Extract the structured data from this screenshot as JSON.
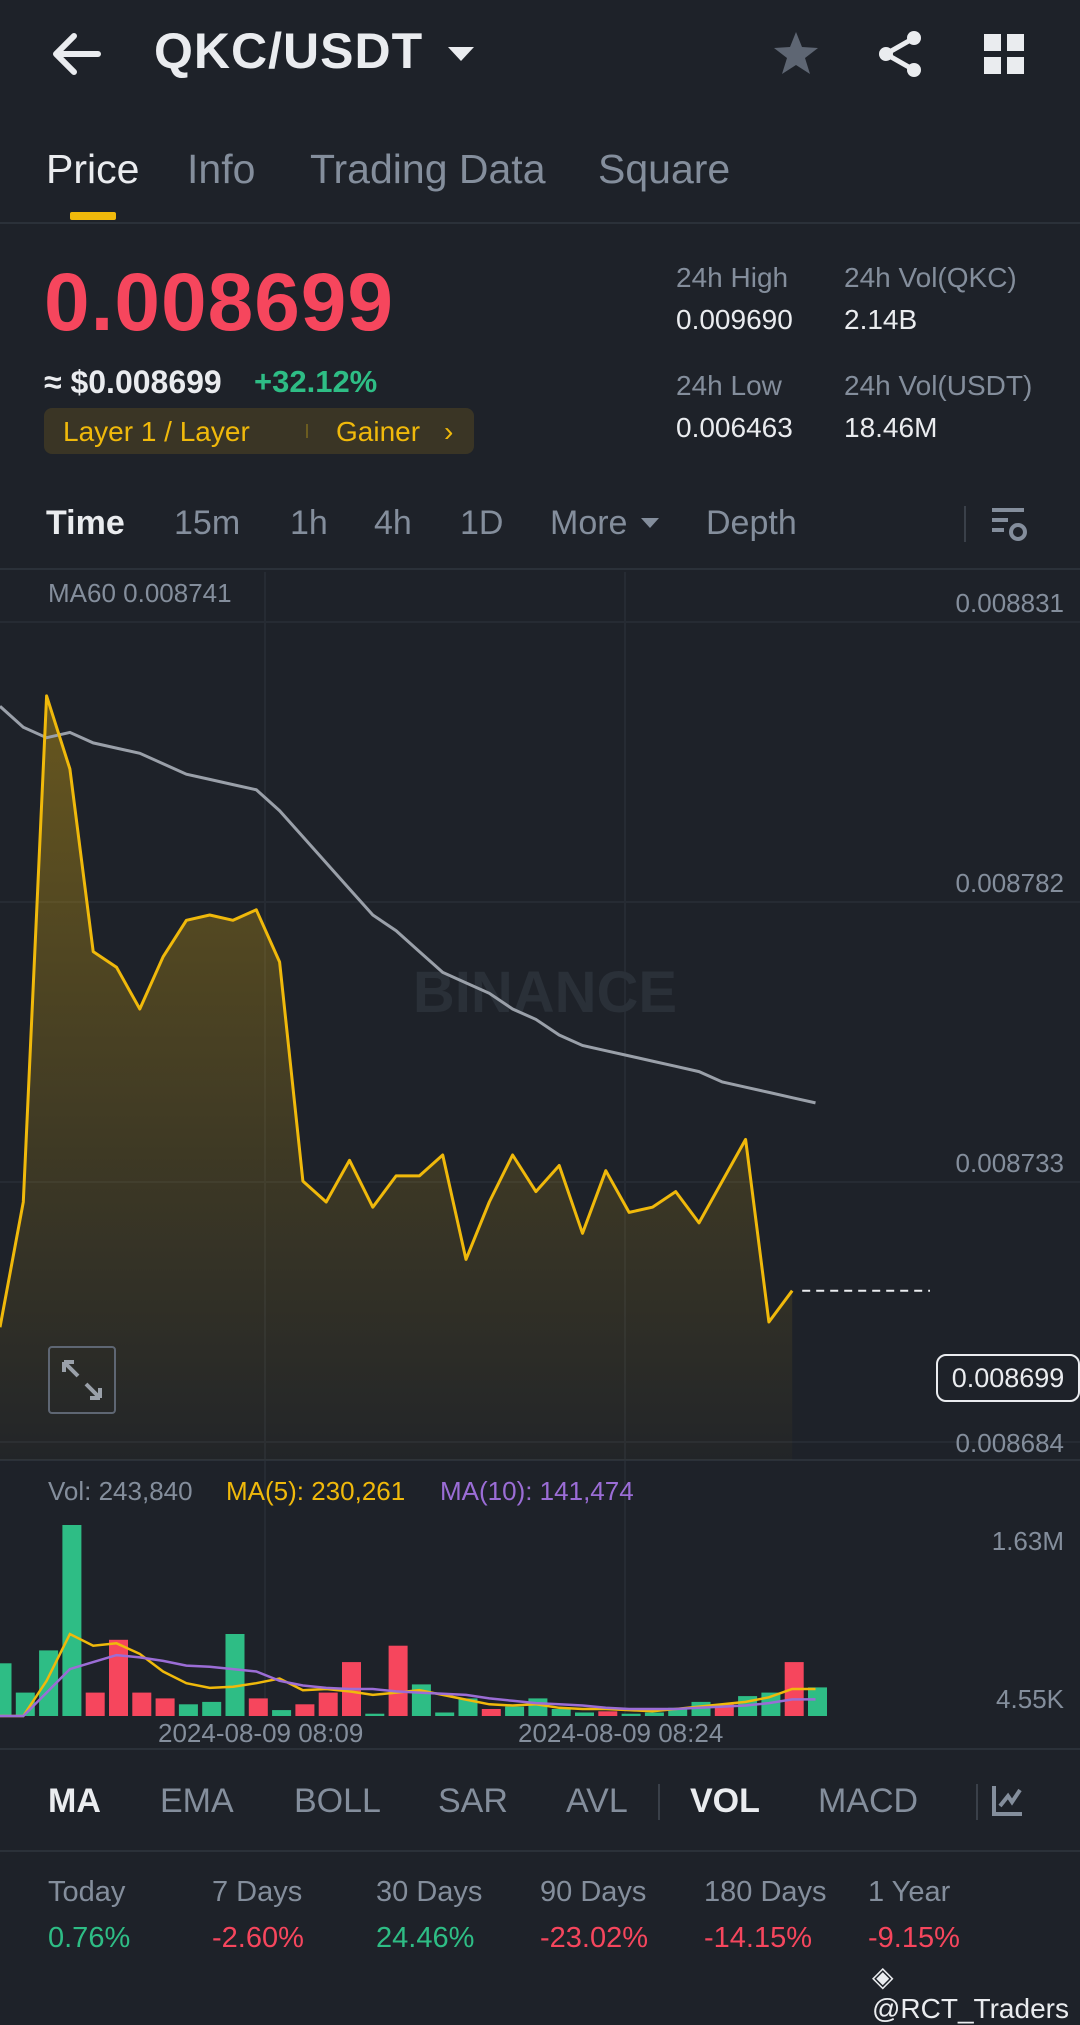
{
  "header": {
    "pair": "QKC/USDT",
    "icons": [
      "back-arrow-icon",
      "dropdown-caret-icon",
      "star-icon",
      "share-icon",
      "grid-icon"
    ]
  },
  "tabs": [
    {
      "label": "Price",
      "active": true
    },
    {
      "label": "Info"
    },
    {
      "label": "Trading Data"
    },
    {
      "label": "Square"
    }
  ],
  "ticker": {
    "last_price": "0.008699",
    "usd_price": "≈ $0.008699",
    "change": "+32.12%",
    "tag_category": "Layer 1 / Layer",
    "tag_rank": "Gainer",
    "high_label": "24h High",
    "high_value": "0.009690",
    "low_label": "24h Low",
    "low_value": "0.006463",
    "vol_base_label": "24h Vol(QKC)",
    "vol_base_value": "2.14B",
    "vol_quote_label": "24h Vol(USDT)",
    "vol_quote_value": "18.46M"
  },
  "intervals": [
    {
      "label": "Time",
      "active": true
    },
    {
      "label": "15m"
    },
    {
      "label": "1h"
    },
    {
      "label": "4h"
    },
    {
      "label": "1D"
    },
    {
      "label": "More"
    },
    {
      "label": "Depth"
    }
  ],
  "chart": {
    "ma_label": "MA60 0.008741",
    "watermark": "BINANCE",
    "price_axis": [
      "0.008831",
      "0.008782",
      "0.008733",
      "0.008684"
    ],
    "current_price_tag": "0.008699",
    "vol_label": "Vol: 243,840",
    "vol_ma5_label": "MA(5): 230,261",
    "vol_ma10_label": "MA(10): 141,474",
    "vol_axis": [
      "1.63M",
      "4.55K"
    ],
    "time_axis": [
      "2024-08-09 08:09",
      "2024-08-09 08:24"
    ],
    "colors": {
      "price_line": "#f0b90b",
      "ma60": "#9aa0a9",
      "up": "#2ebd85",
      "down": "#f6465d",
      "ma5": "#f0b90b",
      "ma10": "#9b6dd6"
    }
  },
  "chart_data": {
    "type": "line",
    "price": {
      "ylim": [
        0.00867,
        0.008831
      ],
      "series": [
        {
          "name": "MA60",
          "values": [
            0.008811,
            0.008807,
            0.008805,
            0.008806,
            0.008804,
            0.008803,
            0.008802,
            0.0088,
            0.008798,
            0.008797,
            0.008796,
            0.008795,
            0.008791,
            0.008786,
            0.008781,
            0.008776,
            0.008771,
            0.008768,
            0.008764,
            0.00876,
            0.008758,
            0.008756,
            0.008753,
            0.008751,
            0.008748,
            0.008746,
            0.008745,
            0.008744,
            0.008743,
            0.008742,
            0.008741,
            0.008739,
            0.008738,
            0.008737,
            0.008736,
            0.008735
          ]
        },
        {
          "values": [
            0.008692,
            0.008716,
            0.008813,
            0.008799,
            0.008764,
            0.008761,
            0.008753,
            0.008763,
            0.00877,
            0.008771,
            0.00877,
            0.008772,
            0.008762,
            0.00872,
            0.008716,
            0.008724,
            0.008715,
            0.008721,
            0.008721,
            0.008725,
            0.008705,
            0.008716,
            0.008725,
            0.008718,
            0.008723,
            0.00871,
            0.008722,
            0.008714,
            0.008715,
            0.008718,
            0.008712,
            0.00872,
            0.008728,
            0.008693,
            0.008699
          ]
        }
      ]
    },
    "volume": {
      "ylim": [
        0,
        1630000
      ],
      "bars": [
        {
          "v": 450000,
          "dir": "up"
        },
        {
          "v": 200000,
          "dir": "up"
        },
        {
          "v": 560000,
          "dir": "up"
        },
        {
          "v": 1630000,
          "dir": "up"
        },
        {
          "v": 200000,
          "dir": "down"
        },
        {
          "v": 650000,
          "dir": "down"
        },
        {
          "v": 200000,
          "dir": "down"
        },
        {
          "v": 150000,
          "dir": "down"
        },
        {
          "v": 100000,
          "dir": "up"
        },
        {
          "v": 120000,
          "dir": "up"
        },
        {
          "v": 700000,
          "dir": "up"
        },
        {
          "v": 150000,
          "dir": "down"
        },
        {
          "v": 50000,
          "dir": "up"
        },
        {
          "v": 100000,
          "dir": "down"
        },
        {
          "v": 200000,
          "dir": "down"
        },
        {
          "v": 460000,
          "dir": "down"
        },
        {
          "v": 20000,
          "dir": "up"
        },
        {
          "v": 600000,
          "dir": "down"
        },
        {
          "v": 270000,
          "dir": "up"
        },
        {
          "v": 30000,
          "dir": "up"
        },
        {
          "v": 150000,
          "dir": "up"
        },
        {
          "v": 60000,
          "dir": "down"
        },
        {
          "v": 80000,
          "dir": "up"
        },
        {
          "v": 150000,
          "dir": "up"
        },
        {
          "v": 60000,
          "dir": "up"
        },
        {
          "v": 30000,
          "dir": "up"
        },
        {
          "v": 40000,
          "dir": "down"
        },
        {
          "v": 20000,
          "dir": "up"
        },
        {
          "v": 30000,
          "dir": "up"
        },
        {
          "v": 70000,
          "dir": "up"
        },
        {
          "v": 120000,
          "dir": "up"
        },
        {
          "v": 100000,
          "dir": "down"
        },
        {
          "v": 170000,
          "dir": "up"
        },
        {
          "v": 200000,
          "dir": "up"
        },
        {
          "v": 460000,
          "dir": "down"
        },
        {
          "v": 243840,
          "dir": "up"
        }
      ],
      "ma5": [
        0,
        0,
        300000,
        700000,
        600000,
        620000,
        530000,
        380000,
        280000,
        240000,
        250000,
        280000,
        320000,
        220000,
        230000,
        210000,
        180000,
        200000,
        220000,
        180000,
        140000,
        100000,
        90000,
        100000,
        70000,
        60000,
        60000,
        50000,
        40000,
        60000,
        80000,
        100000,
        120000,
        160000,
        230261,
        230261
      ],
      "ma10": [
        0,
        0,
        200000,
        400000,
        460000,
        520000,
        500000,
        470000,
        430000,
        420000,
        400000,
        380000,
        300000,
        260000,
        240000,
        230000,
        230000,
        210000,
        200000,
        190000,
        180000,
        150000,
        130000,
        110000,
        100000,
        90000,
        70000,
        60000,
        60000,
        60000,
        70000,
        80000,
        90000,
        110000,
        141474,
        141474
      ]
    },
    "time_ticks": [
      "2024-08-09 08:09",
      "2024-08-09 08:24"
    ]
  },
  "indicators": [
    {
      "label": "MA",
      "active": true
    },
    {
      "label": "EMA"
    },
    {
      "label": "BOLL"
    },
    {
      "label": "SAR"
    },
    {
      "label": "AVL"
    },
    {
      "label": "VOL",
      "active": true
    },
    {
      "label": "MACD"
    }
  ],
  "performance": [
    {
      "label": "Today",
      "value": "0.76%",
      "dir": "up"
    },
    {
      "label": "7 Days",
      "value": "-2.60%",
      "dir": "down"
    },
    {
      "label": "30 Days",
      "value": "24.46%",
      "dir": "up"
    },
    {
      "label": "90 Days",
      "value": "-23.02%",
      "dir": "down"
    },
    {
      "label": "180 Days",
      "value": "-14.15%",
      "dir": "down"
    },
    {
      "label": "1 Year",
      "value": "-9.15%",
      "dir": "down"
    }
  ],
  "watermark_user": "@RCT_Traders"
}
